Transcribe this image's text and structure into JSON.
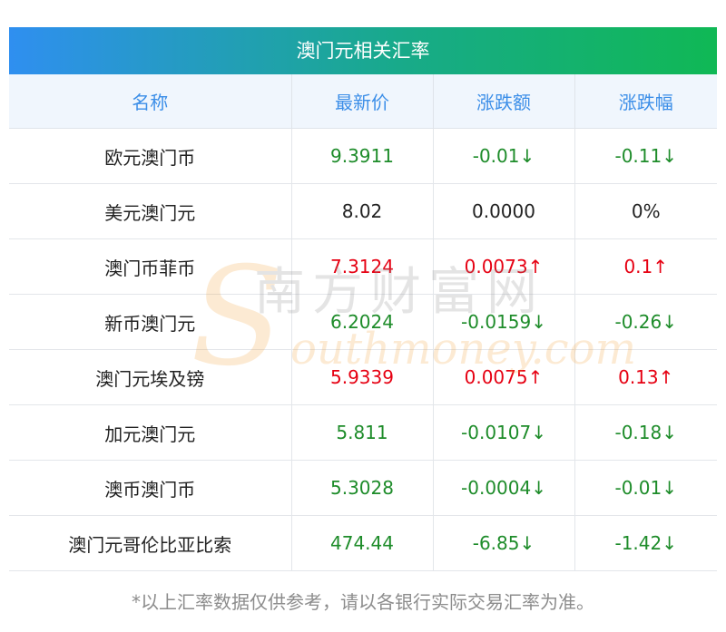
{
  "title": "澳门元相关汇率",
  "columns": [
    "名称",
    "最新价",
    "涨跌额",
    "涨跌幅"
  ],
  "rows": [
    {
      "name": "欧元澳门币",
      "price": "9.3911",
      "change": "-0.01↓",
      "pct": "-0.11↓",
      "trend": "down"
    },
    {
      "name": "美元澳门元",
      "price": "8.02",
      "change": "0.0000",
      "pct": "0%",
      "trend": "flat"
    },
    {
      "name": "澳门币菲币",
      "price": "7.3124",
      "change": "0.0073↑",
      "pct": "0.1↑",
      "trend": "up"
    },
    {
      "name": "新币澳门元",
      "price": "6.2024",
      "change": "-0.0159↓",
      "pct": "-0.26↓",
      "trend": "down"
    },
    {
      "name": "澳门元埃及镑",
      "price": "5.9339",
      "change": "0.0075↑",
      "pct": "0.13↑",
      "trend": "up"
    },
    {
      "name": "加元澳门元",
      "price": "5.811",
      "change": "-0.0107↓",
      "pct": "-0.18↓",
      "trend": "down"
    },
    {
      "name": "澳币澳门币",
      "price": "5.3028",
      "change": "-0.0004↓",
      "pct": "-0.01↓",
      "trend": "down"
    },
    {
      "name": "澳门元哥伦比亚比索",
      "price": "474.44",
      "change": "-6.85↓",
      "pct": "-1.42↓",
      "trend": "down"
    }
  ],
  "watermark": {
    "logo_letter": "S",
    "cn": "南方财富网",
    "en": "outhmoney.com"
  },
  "footnote": "*以上汇率数据仅供参考，请以各银行实际交易汇率为准。",
  "colors": {
    "up": "#e60012",
    "down": "#1e8c2a",
    "flat": "#222222",
    "header_text": "#3b8ee8",
    "header_bg": "#f0f6fd",
    "title_gradient_start": "#2f8ff0",
    "title_gradient_end": "#10b855"
  }
}
